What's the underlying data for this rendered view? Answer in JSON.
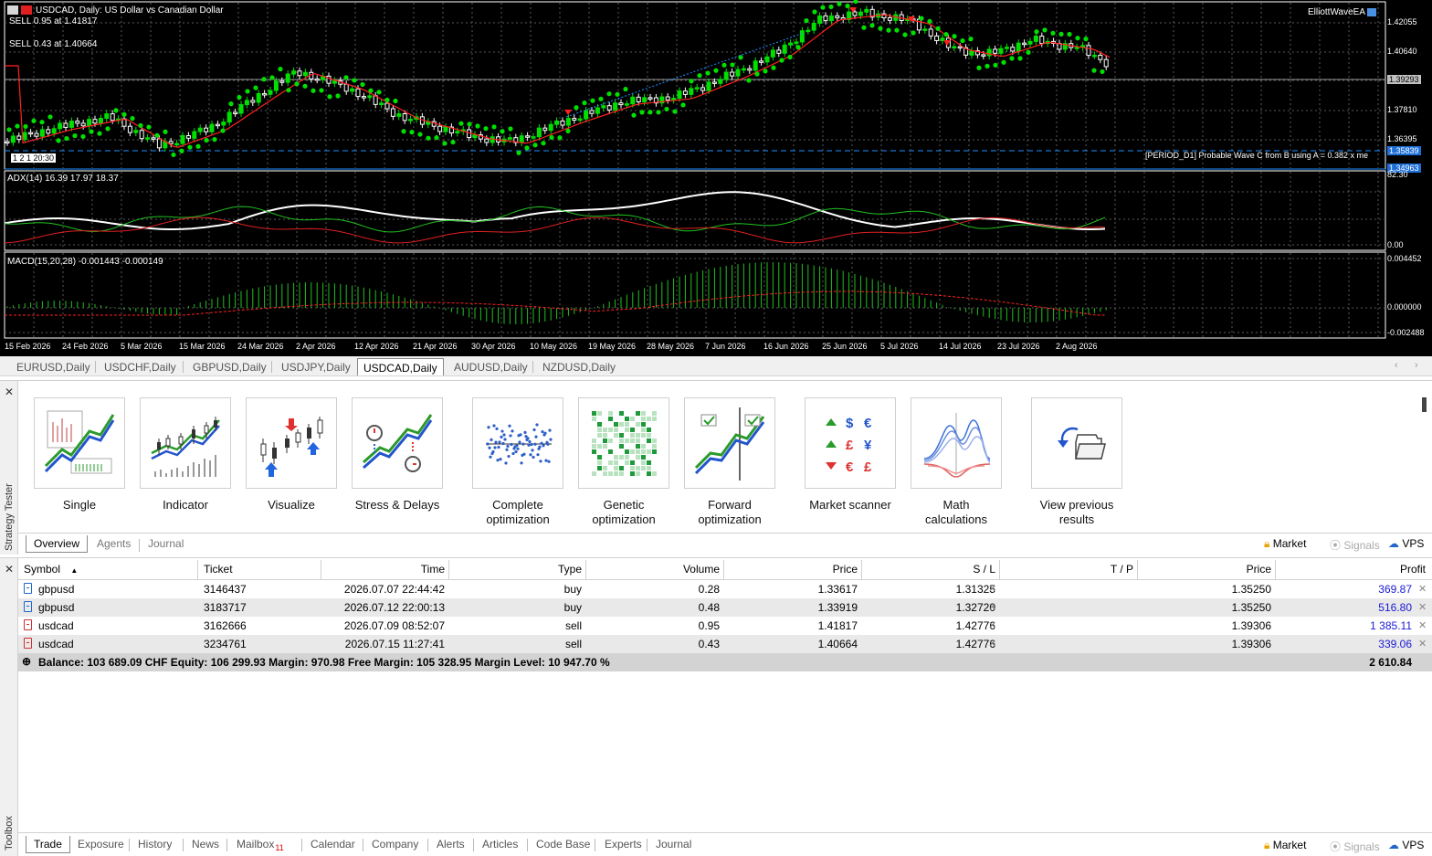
{
  "chart": {
    "title": "USDCAD, Daily:  US Dollar vs Canadian Dollar",
    "ea_name": "ElliottWaveEA",
    "order_labels": [
      "SELL 0.95 at 1.41817",
      "SELL 0.43 at 1.40664"
    ],
    "timer": "1 2 1 20:30",
    "adx_label": "ADX(14) 16.39 17.97 18.37",
    "macd_label": "MACD(15,20,28) -0.001443 -0.000149",
    "wave_note": "[PERIOD_D1] Probable Wave C from B using A = 0.382 x me",
    "price_axis": [
      "1.42055",
      "1.40640",
      "1.39293",
      "1.37810",
      "1.36395",
      "1.35839",
      "1.34963"
    ],
    "adx_axis": [
      "82.30",
      "0.00"
    ],
    "macd_axis": [
      "0.004452",
      "0.000000",
      "-0.002488"
    ],
    "dates": [
      "15 Feb 2026",
      "24 Feb 2026",
      "5 Mar 2026",
      "15 Mar 2026",
      "24 Mar 2026",
      "2 Apr 2026",
      "12 Apr 2026",
      "21 Apr 2026",
      "30 Apr 2026",
      "10 May 2026",
      "19 May 2026",
      "28 May 2026",
      "7 Jun 2026",
      "16 Jun 2026",
      "25 Jun 2026",
      "5 Jul 2026",
      "14 Jul 2026",
      "23 Jul 2026",
      "2 Aug 2026"
    ],
    "colors": {
      "bull": "#00e000",
      "bear": "#ffffff",
      "signal": "#ff2020",
      "adx_main": "#ffffff",
      "di_plus": "#20c020",
      "di_minus": "#e02020",
      "macd_hist": "#20c020",
      "wave_note": "#1e90ff"
    }
  },
  "chart_tabs": [
    "EURUSD,Daily",
    "USDCHF,Daily",
    "GBPUSD,Daily",
    "USDJPY,Daily",
    "USDCAD,Daily",
    "AUDUSD,Daily",
    "NZDUSD,Daily"
  ],
  "chart_tabs_active": "USDCAD,Daily",
  "tester": {
    "side_title": "Strategy Tester",
    "modes": [
      {
        "label": "Single",
        "icon": "single-test-icon"
      },
      {
        "label": "Indicator",
        "icon": "indicator-test-icon"
      },
      {
        "label": "Visualize",
        "icon": "visualize-icon"
      },
      {
        "label": "Stress & Delays",
        "icon": "stress-delays-icon"
      },
      {
        "label": "Complete optimization",
        "icon": "complete-optimization-icon"
      },
      {
        "label": "Genetic optimization",
        "icon": "genetic-optimization-icon"
      },
      {
        "label": "Forward optimization",
        "icon": "forward-optimization-icon"
      },
      {
        "label": "Market scanner",
        "icon": "market-scanner-icon"
      },
      {
        "label": "Math calculations",
        "icon": "math-calculations-icon"
      },
      {
        "label": "View previous results",
        "icon": "view-previous-results-icon"
      }
    ],
    "tabs": [
      "Overview",
      "Agents",
      "Journal"
    ],
    "active_tab": "Overview",
    "links": [
      "Market",
      "Signals",
      "VPS"
    ]
  },
  "toolbox": {
    "side_title": "Toolbox",
    "columns": [
      "Symbol",
      "Ticket",
      "Time",
      "Type",
      "Volume",
      "Price",
      "S / L",
      "T / P",
      "Price",
      "Profit"
    ],
    "rows": [
      {
        "symbol": "gbpusd",
        "ticket": "3146437",
        "time": "2026.07.07 22:44:42",
        "type": "buy",
        "volume": "0.28",
        "price": "1.33617",
        "sl": "1.31325",
        "tp": "",
        "current": "1.35250",
        "profit": "369.87"
      },
      {
        "symbol": "gbpusd",
        "ticket": "3183717",
        "time": "2026.07.12 22:00:13",
        "type": "buy",
        "volume": "0.48",
        "price": "1.33919",
        "sl": "1.32720",
        "tp": "",
        "current": "1.35250",
        "profit": "516.80"
      },
      {
        "symbol": "usdcad",
        "ticket": "3162666",
        "time": "2026.07.09 08:52:07",
        "type": "sell",
        "volume": "0.95",
        "price": "1.41817",
        "sl": "1.42776",
        "tp": "",
        "current": "1.39306",
        "profit": "1 385.11"
      },
      {
        "symbol": "usdcad",
        "ticket": "3234761",
        "time": "2026.07.15 11:27:41",
        "type": "sell",
        "volume": "0.43",
        "price": "1.40664",
        "sl": "1.42776",
        "tp": "",
        "current": "1.39306",
        "profit": "339.06"
      }
    ],
    "balance_line": "Balance: 103 689.09 CHF  Equity: 106 299.93  Margin: 970.98  Free Margin: 105 328.95  Margin Level: 10 947.70 %",
    "total_profit": "2 610.84",
    "tabs": [
      "Trade",
      "Exposure",
      "History",
      "News",
      "Mailbox",
      "Calendar",
      "Company",
      "Alerts",
      "Articles",
      "Code Base",
      "Experts",
      "Journal"
    ],
    "active_tab": "Trade",
    "mailbox_count": "11",
    "links": [
      "Market",
      "Signals",
      "VPS"
    ]
  }
}
